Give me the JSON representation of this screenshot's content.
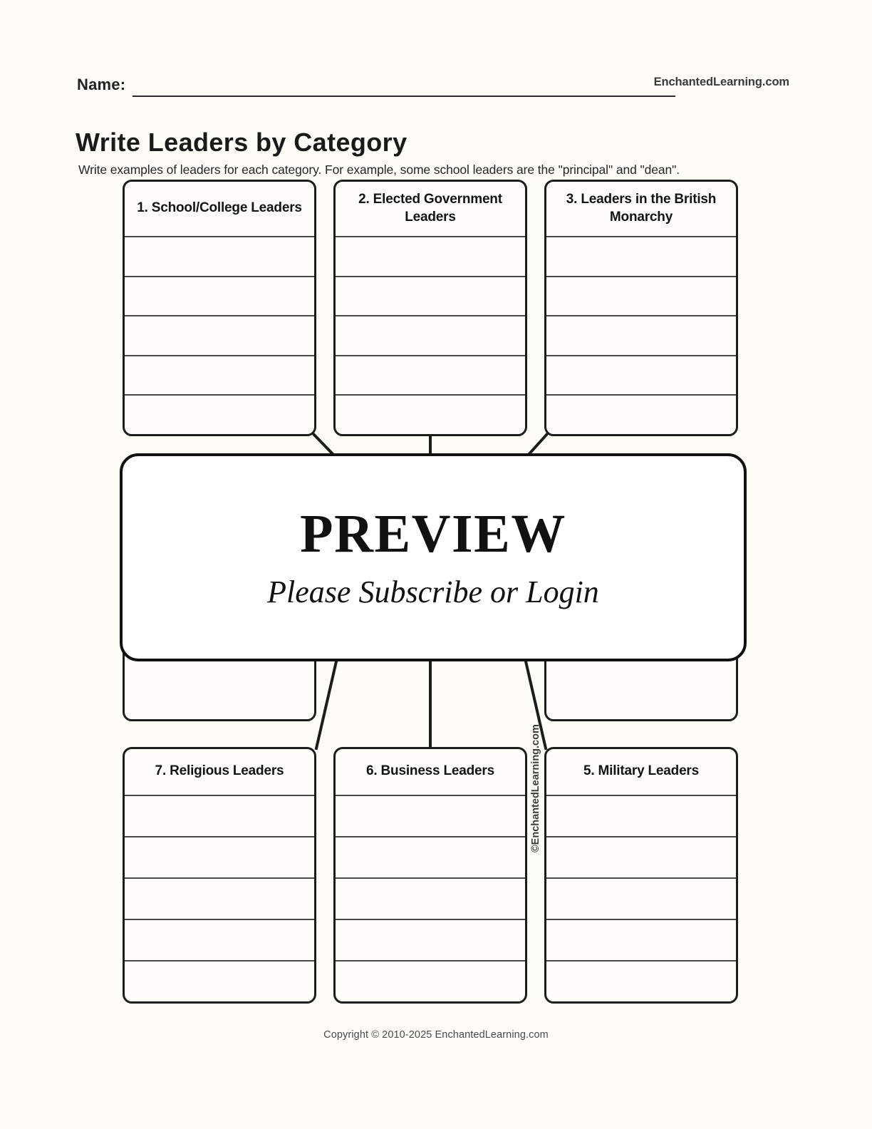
{
  "header": {
    "name_label": "Name:",
    "brand": "EnchantedLearning.com"
  },
  "worksheet": {
    "title": "Write Leaders by Category",
    "directions": "Write examples of leaders for each category. For example, some school leaders are the \"principal\" and \"dean\"."
  },
  "boxes": {
    "top": [
      {
        "id": 1,
        "label": "1. School/College Leaders",
        "rows": 5
      },
      {
        "id": 2,
        "label": "2. Elected Government Leaders",
        "rows": 5
      },
      {
        "id": 3,
        "label": "3. Leaders in the British Monarchy",
        "rows": 5
      }
    ],
    "middle": [
      {
        "id": 8,
        "label": "",
        "rows": 2
      },
      {
        "id": 4,
        "label": "",
        "rows": 2
      }
    ],
    "bottom": [
      {
        "id": 7,
        "label": "7. Religious Leaders",
        "rows": 5
      },
      {
        "id": 6,
        "label": "6. Business Leaders",
        "rows": 5
      },
      {
        "id": 5,
        "label": "5. Military Leaders",
        "rows": 5
      }
    ]
  },
  "preview": {
    "title": "PREVIEW",
    "subtitle": "Please Subscribe or Login"
  },
  "side_credit": "©EnchantedLearning.com",
  "footer": {
    "copyright": "Copyright © 2010-2025 EnchantedLearning.com"
  },
  "colors": {
    "page_background": "#fdfcf7",
    "box_fill": "#fdfcf8",
    "box_border": "#1c1c1c",
    "row_rule": "#4a4a4a",
    "preview_fill": "#ffffff",
    "text": "#1a1a1a"
  }
}
